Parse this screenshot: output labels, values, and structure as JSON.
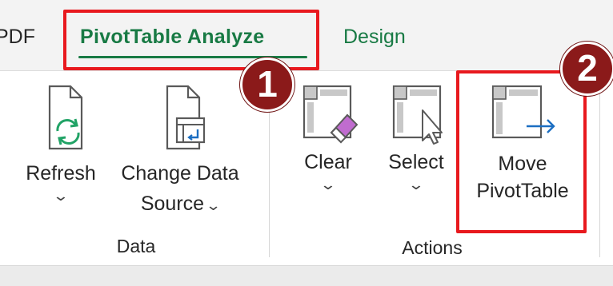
{
  "tabs": {
    "pdf": "PDF",
    "pivottable_analyze": "PivotTable Analyze",
    "design": "Design"
  },
  "groups": {
    "data": {
      "label": "Data",
      "refresh": {
        "label": "Refresh",
        "icon": "refresh-icon"
      },
      "change_data_source": {
        "label_line1": "Change Data",
        "label_line2": "Source",
        "icon": "change-data-source-icon"
      }
    },
    "actions": {
      "label": "Actions",
      "clear": {
        "label": "Clear",
        "icon": "clear-eraser-icon"
      },
      "select": {
        "label": "Select",
        "icon": "select-cursor-icon"
      },
      "move_pivottable": {
        "label_line1": "Move",
        "label_line2": "PivotTable",
        "icon": "move-pivottable-icon"
      }
    }
  },
  "callouts": {
    "step1": "1",
    "step2": "2"
  },
  "colors": {
    "accent_green": "#187a44",
    "highlight_red": "#e8191e",
    "badge_maroon": "#8b1a1a"
  }
}
